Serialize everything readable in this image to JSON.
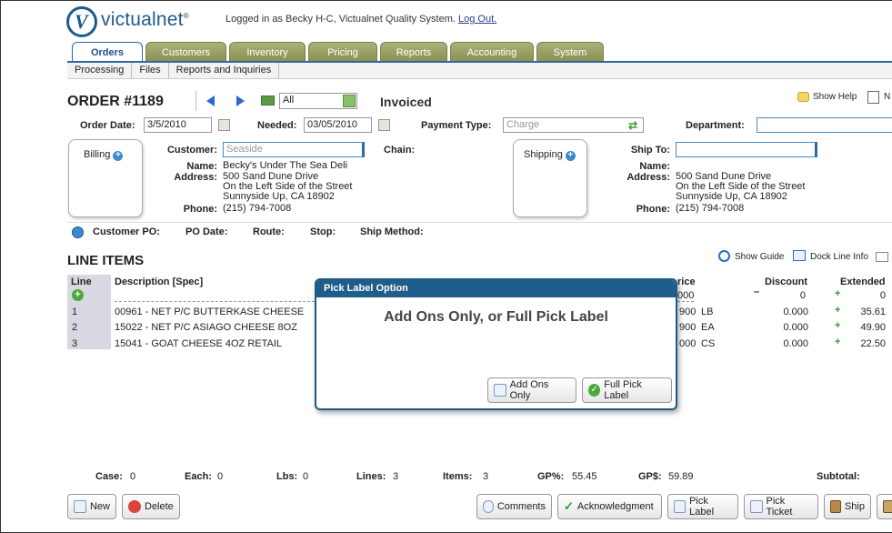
{
  "header": {
    "logo_text": "victualnet",
    "logo_reg": "®",
    "logged_prefix": "Logged in as Becky H-C, Victualnet Quality System.",
    "logout": "Log Out."
  },
  "tabs": [
    "Orders",
    "Customers",
    "Inventory",
    "Pricing",
    "Reports",
    "Accounting",
    "System"
  ],
  "subnav": [
    "Processing",
    "Files",
    "Reports and Inquiries"
  ],
  "order": {
    "title": "ORDER #1189",
    "filter": "All",
    "status": "Invoiced",
    "show_help": "Show Help",
    "order_date_label": "Order Date:",
    "order_date": "3/5/2010",
    "needed_label": "Needed:",
    "needed": "03/05/2010",
    "payment_type_label": "Payment Type:",
    "payment_type_placeholder": "Charge",
    "department_label": "Department:"
  },
  "billing": {
    "title": "Billing",
    "customer_label": "Customer:",
    "customer_placeholder": "Seaside",
    "chain_label": "Chain:",
    "name_label": "Name:",
    "name": "Becky's Under The Sea Deli",
    "address_label": "Address:",
    "address1": "500 Sand Dune Drive",
    "address2": "On the Left Side of the Street",
    "address3": "Sunnyside Up, CA 18902",
    "phone_label": "Phone:",
    "phone": "(215) 794-7008"
  },
  "shipping": {
    "title": "Shipping",
    "ship_to_label": "Ship To:",
    "name_label": "Name:",
    "address_label": "Address:",
    "address1": "500 Sand Dune Drive",
    "address2": "On the Left Side of the Street",
    "address3": "Sunnyside Up, CA 18902",
    "phone_label": "Phone:",
    "phone": "(215) 794-7008"
  },
  "info": {
    "customer_po": "Customer PO:",
    "po_date": "PO Date:",
    "route": "Route:",
    "stop": "Stop:",
    "ship_method": "Ship Method:"
  },
  "line_items": {
    "title": "LINE ITEMS",
    "show_guide": "Show Guide",
    "dock_line_info": "Dock Line Info",
    "col_line": "Line",
    "col_desc": "Description [Spec]",
    "col_price": "rice",
    "col_discount": "Discount",
    "col_extended": "Extended",
    "header_row": {
      "price": "000",
      "discount": "0",
      "extended": "0"
    },
    "rows": [
      {
        "line": "1",
        "desc": "00961 - NET P/C BUTTERKASE CHEESE",
        "price": "900",
        "unit": "LB",
        "discount": "0.000",
        "extended": "35.61"
      },
      {
        "line": "2",
        "desc": "15022 - NET P/C ASIAGO CHEESE 8OZ",
        "price": "900",
        "unit": "EA",
        "discount": "0.000",
        "extended": "49.90"
      },
      {
        "line": "3",
        "desc": "15041 - GOAT CHEESE 4OZ RETAIL",
        "price": "000",
        "unit": "CS",
        "discount": "0.000",
        "extended": "22.50"
      }
    ]
  },
  "modal": {
    "title": "Pick Label Option",
    "message": "Add Ons Only, or Full Pick Label",
    "btn_addons": "Add Ons Only",
    "btn_full": "Full Pick Label"
  },
  "totals": {
    "case_label": "Case:",
    "case": "0",
    "each_label": "Each:",
    "each": "0",
    "lbs_label": "Lbs:",
    "lbs": "0",
    "lines_label": "Lines:",
    "lines": "3",
    "items_label": "Items:",
    "items": "3",
    "gp_pct_label": "GP%:",
    "gp_pct": "55.45",
    "gp_dollar_label": "GP$:",
    "gp_dollar": "59.89",
    "subtotal_label": "Subtotal:"
  },
  "buttons": {
    "new": "New",
    "delete": "Delete",
    "comments": "Comments",
    "acknowledgment": "Acknowledgment",
    "pick_label": "Pick Label",
    "pick_ticket": "Pick Ticket",
    "ship": "Ship"
  }
}
